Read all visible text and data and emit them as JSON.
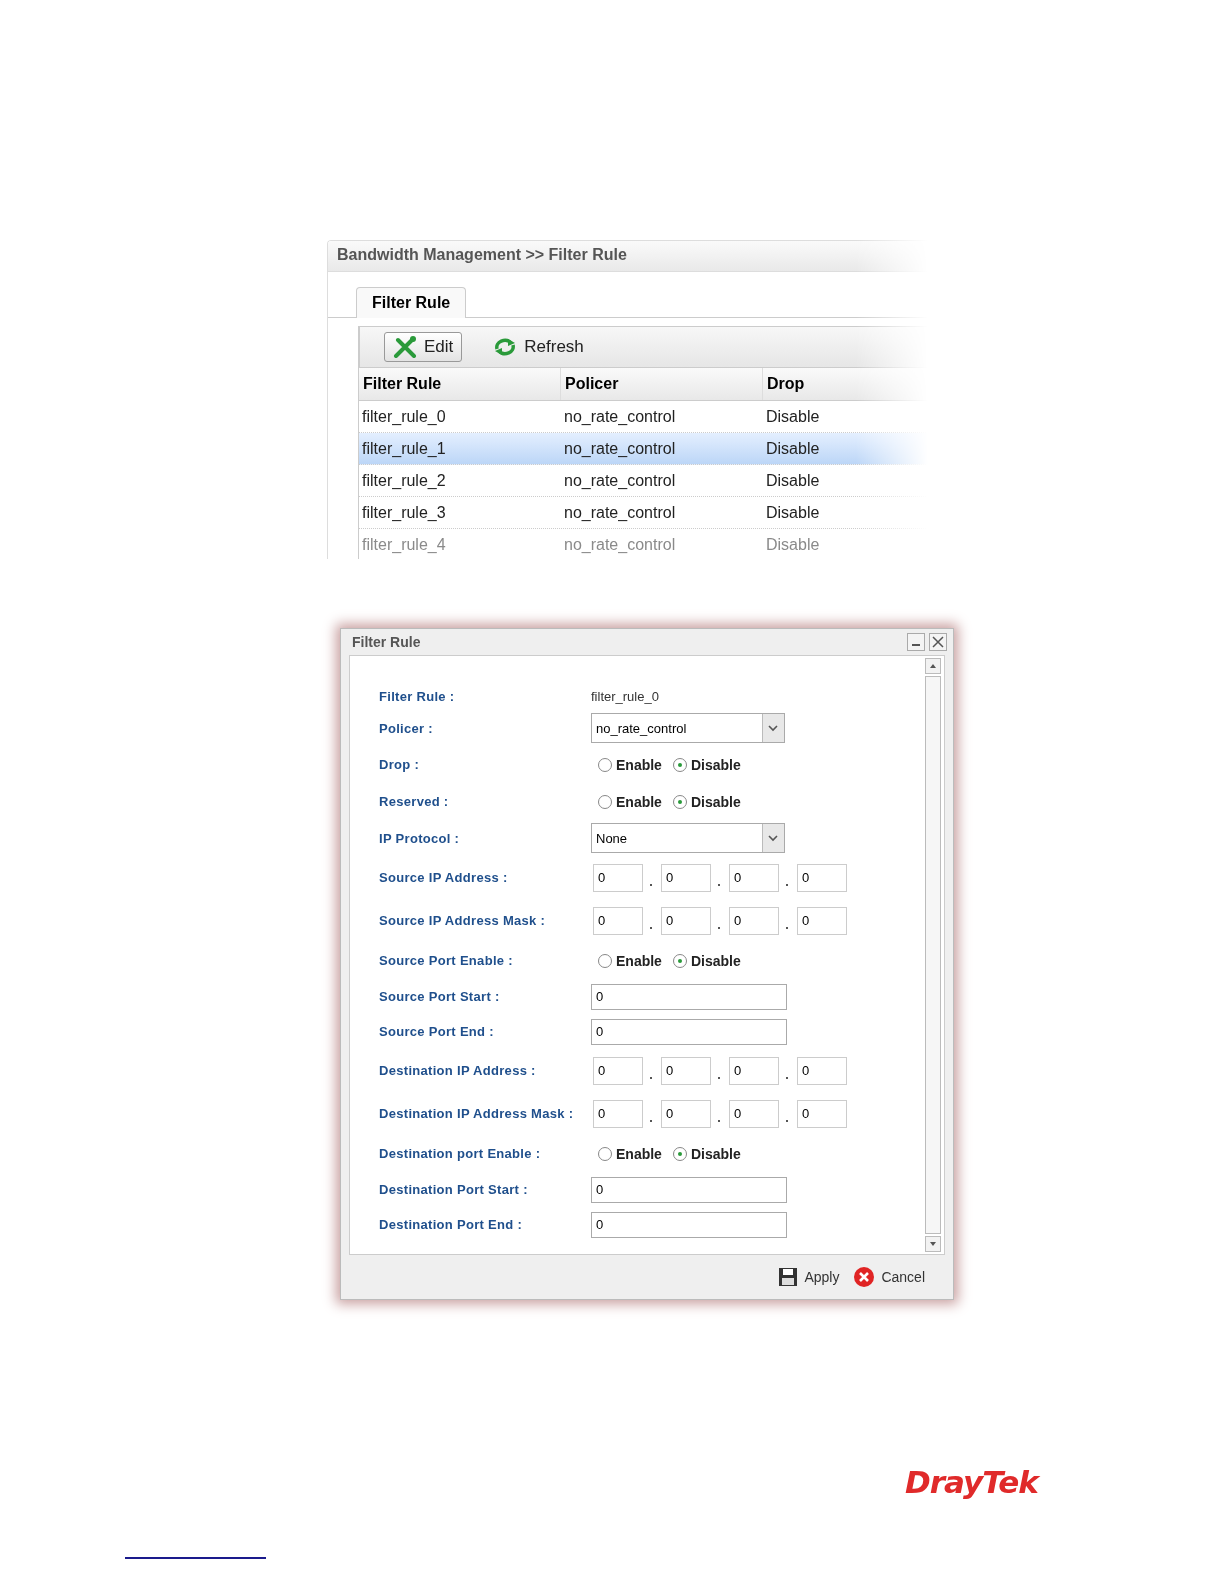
{
  "panel": {
    "breadcrumb": "Bandwidth Management >> Filter Rule",
    "tabs": [
      {
        "label": "Filter Rule",
        "selected": true
      }
    ],
    "toolbar": [
      {
        "kind": "edit",
        "label": "Edit"
      },
      {
        "kind": "refresh",
        "label": "Refresh"
      }
    ],
    "table": {
      "columns": [
        "Filter Rule",
        "Policer",
        "Drop"
      ],
      "rows": [
        {
          "cells": [
            "filter_rule_0",
            "no_rate_control",
            "Disable"
          ],
          "selected": false,
          "faded": false
        },
        {
          "cells": [
            "filter_rule_1",
            "no_rate_control",
            "Disable"
          ],
          "selected": true,
          "faded": false
        },
        {
          "cells": [
            "filter_rule_2",
            "no_rate_control",
            "Disable"
          ],
          "selected": false,
          "faded": false
        },
        {
          "cells": [
            "filter_rule_3",
            "no_rate_control",
            "Disable"
          ],
          "selected": false,
          "faded": false
        },
        {
          "cells": [
            "filter_rule_4",
            "no_rate_control",
            "Disable"
          ],
          "selected": false,
          "faded": true
        }
      ]
    }
  },
  "dialog": {
    "title": "Filter Rule",
    "fields": [
      {
        "kind": "text",
        "label": "Filter Rule :",
        "value": "filter_rule_0"
      },
      {
        "kind": "select",
        "label": "Policer :",
        "value": "no_rate_control"
      },
      {
        "kind": "radio",
        "label": "Drop :",
        "options": [
          {
            "label": "Enable",
            "selected": false
          },
          {
            "label": "Disable",
            "selected": true
          }
        ]
      },
      {
        "kind": "radio",
        "label": "Reserved :",
        "options": [
          {
            "label": "Enable",
            "selected": false
          },
          {
            "label": "Disable",
            "selected": true
          }
        ]
      },
      {
        "kind": "select",
        "label": "IP Protocol :",
        "value": "None"
      },
      {
        "kind": "ip",
        "label": "Source IP Address :",
        "octets": [
          "0",
          "0",
          "0",
          "0"
        ]
      },
      {
        "kind": "ip",
        "label": "Source IP Address Mask :",
        "octets": [
          "0",
          "0",
          "0",
          "0"
        ]
      },
      {
        "kind": "radio",
        "label": "Source Port Enable :",
        "options": [
          {
            "label": "Enable",
            "selected": false
          },
          {
            "label": "Disable",
            "selected": true
          }
        ]
      },
      {
        "kind": "input",
        "label": "Source Port Start :",
        "value": "0"
      },
      {
        "kind": "input",
        "label": "Source Port End :",
        "value": "0"
      },
      {
        "kind": "ip",
        "label": "Destination IP Address :",
        "octets": [
          "0",
          "0",
          "0",
          "0"
        ]
      },
      {
        "kind": "ip",
        "label": "Destination IP Address Mask :",
        "octets": [
          "0",
          "0",
          "0",
          "0"
        ]
      },
      {
        "kind": "radio",
        "label": "Destination port Enable :",
        "options": [
          {
            "label": "Enable",
            "selected": false
          },
          {
            "label": "Disable",
            "selected": true
          }
        ]
      },
      {
        "kind": "input",
        "label": "Destination Port Start :",
        "value": "0"
      },
      {
        "kind": "input",
        "label": "Destination Port End :",
        "value": "0"
      }
    ],
    "buttons": [
      {
        "kind": "apply",
        "label": "Apply"
      },
      {
        "kind": "cancel",
        "label": "Cancel"
      }
    ]
  },
  "footer": {
    "logo": "DrayTek"
  }
}
